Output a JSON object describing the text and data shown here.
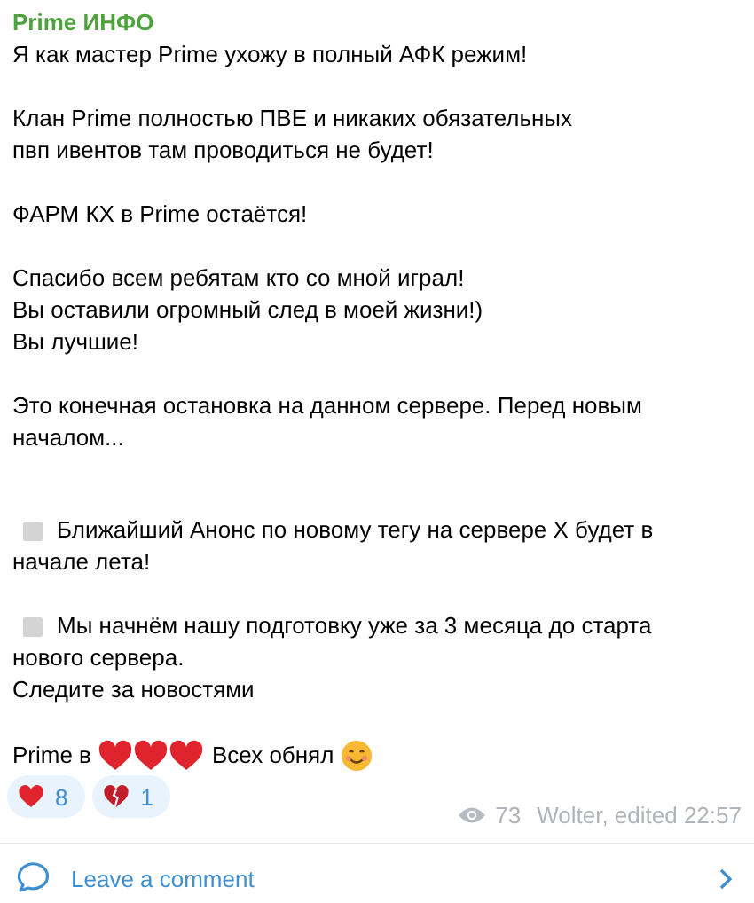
{
  "channel": {
    "name": "Prime ИНФО"
  },
  "paragraphs": [
    {
      "kind": "text",
      "lines": [
        "Я как мастер Prime ухожу в полный АФК режим!"
      ]
    },
    {
      "kind": "text",
      "lines": [
        "Клан Prime полностью ПВЕ и никаких обязательных",
        "пвп ивентов там проводиться не будет!"
      ]
    },
    {
      "kind": "text",
      "lines": [
        "ФАРМ КХ в Prime остаётся!"
      ]
    },
    {
      "kind": "text",
      "lines": [
        "Спасибо всем ребятам кто со мной играл!",
        "Вы оставили огромный след в моей жизни!)",
        "Вы лучшие!"
      ]
    },
    {
      "kind": "text",
      "lines": [
        "Это конечная остановка на данном сервере. Перед новым",
        "началом..."
      ]
    },
    {
      "kind": "bullet",
      "lines": [
        "Ближайший Анонс по новому тегу на сервере X будет в",
        "начале лета!"
      ]
    },
    {
      "kind": "bullet",
      "lines": [
        "Мы начнём нашу подготовку уже за 3 месяца до старта",
        "нового сервера.",
        "Следите за новостями"
      ]
    }
  ],
  "closing": {
    "before": "Prime в",
    "after": "Всех обнял"
  },
  "reactions": [
    {
      "kind": "heart",
      "count": "8"
    },
    {
      "kind": "broken-heart",
      "count": "1"
    }
  ],
  "views": "73",
  "signature": "Wolter, edited 22:57",
  "comment_link": "Leave a comment"
}
